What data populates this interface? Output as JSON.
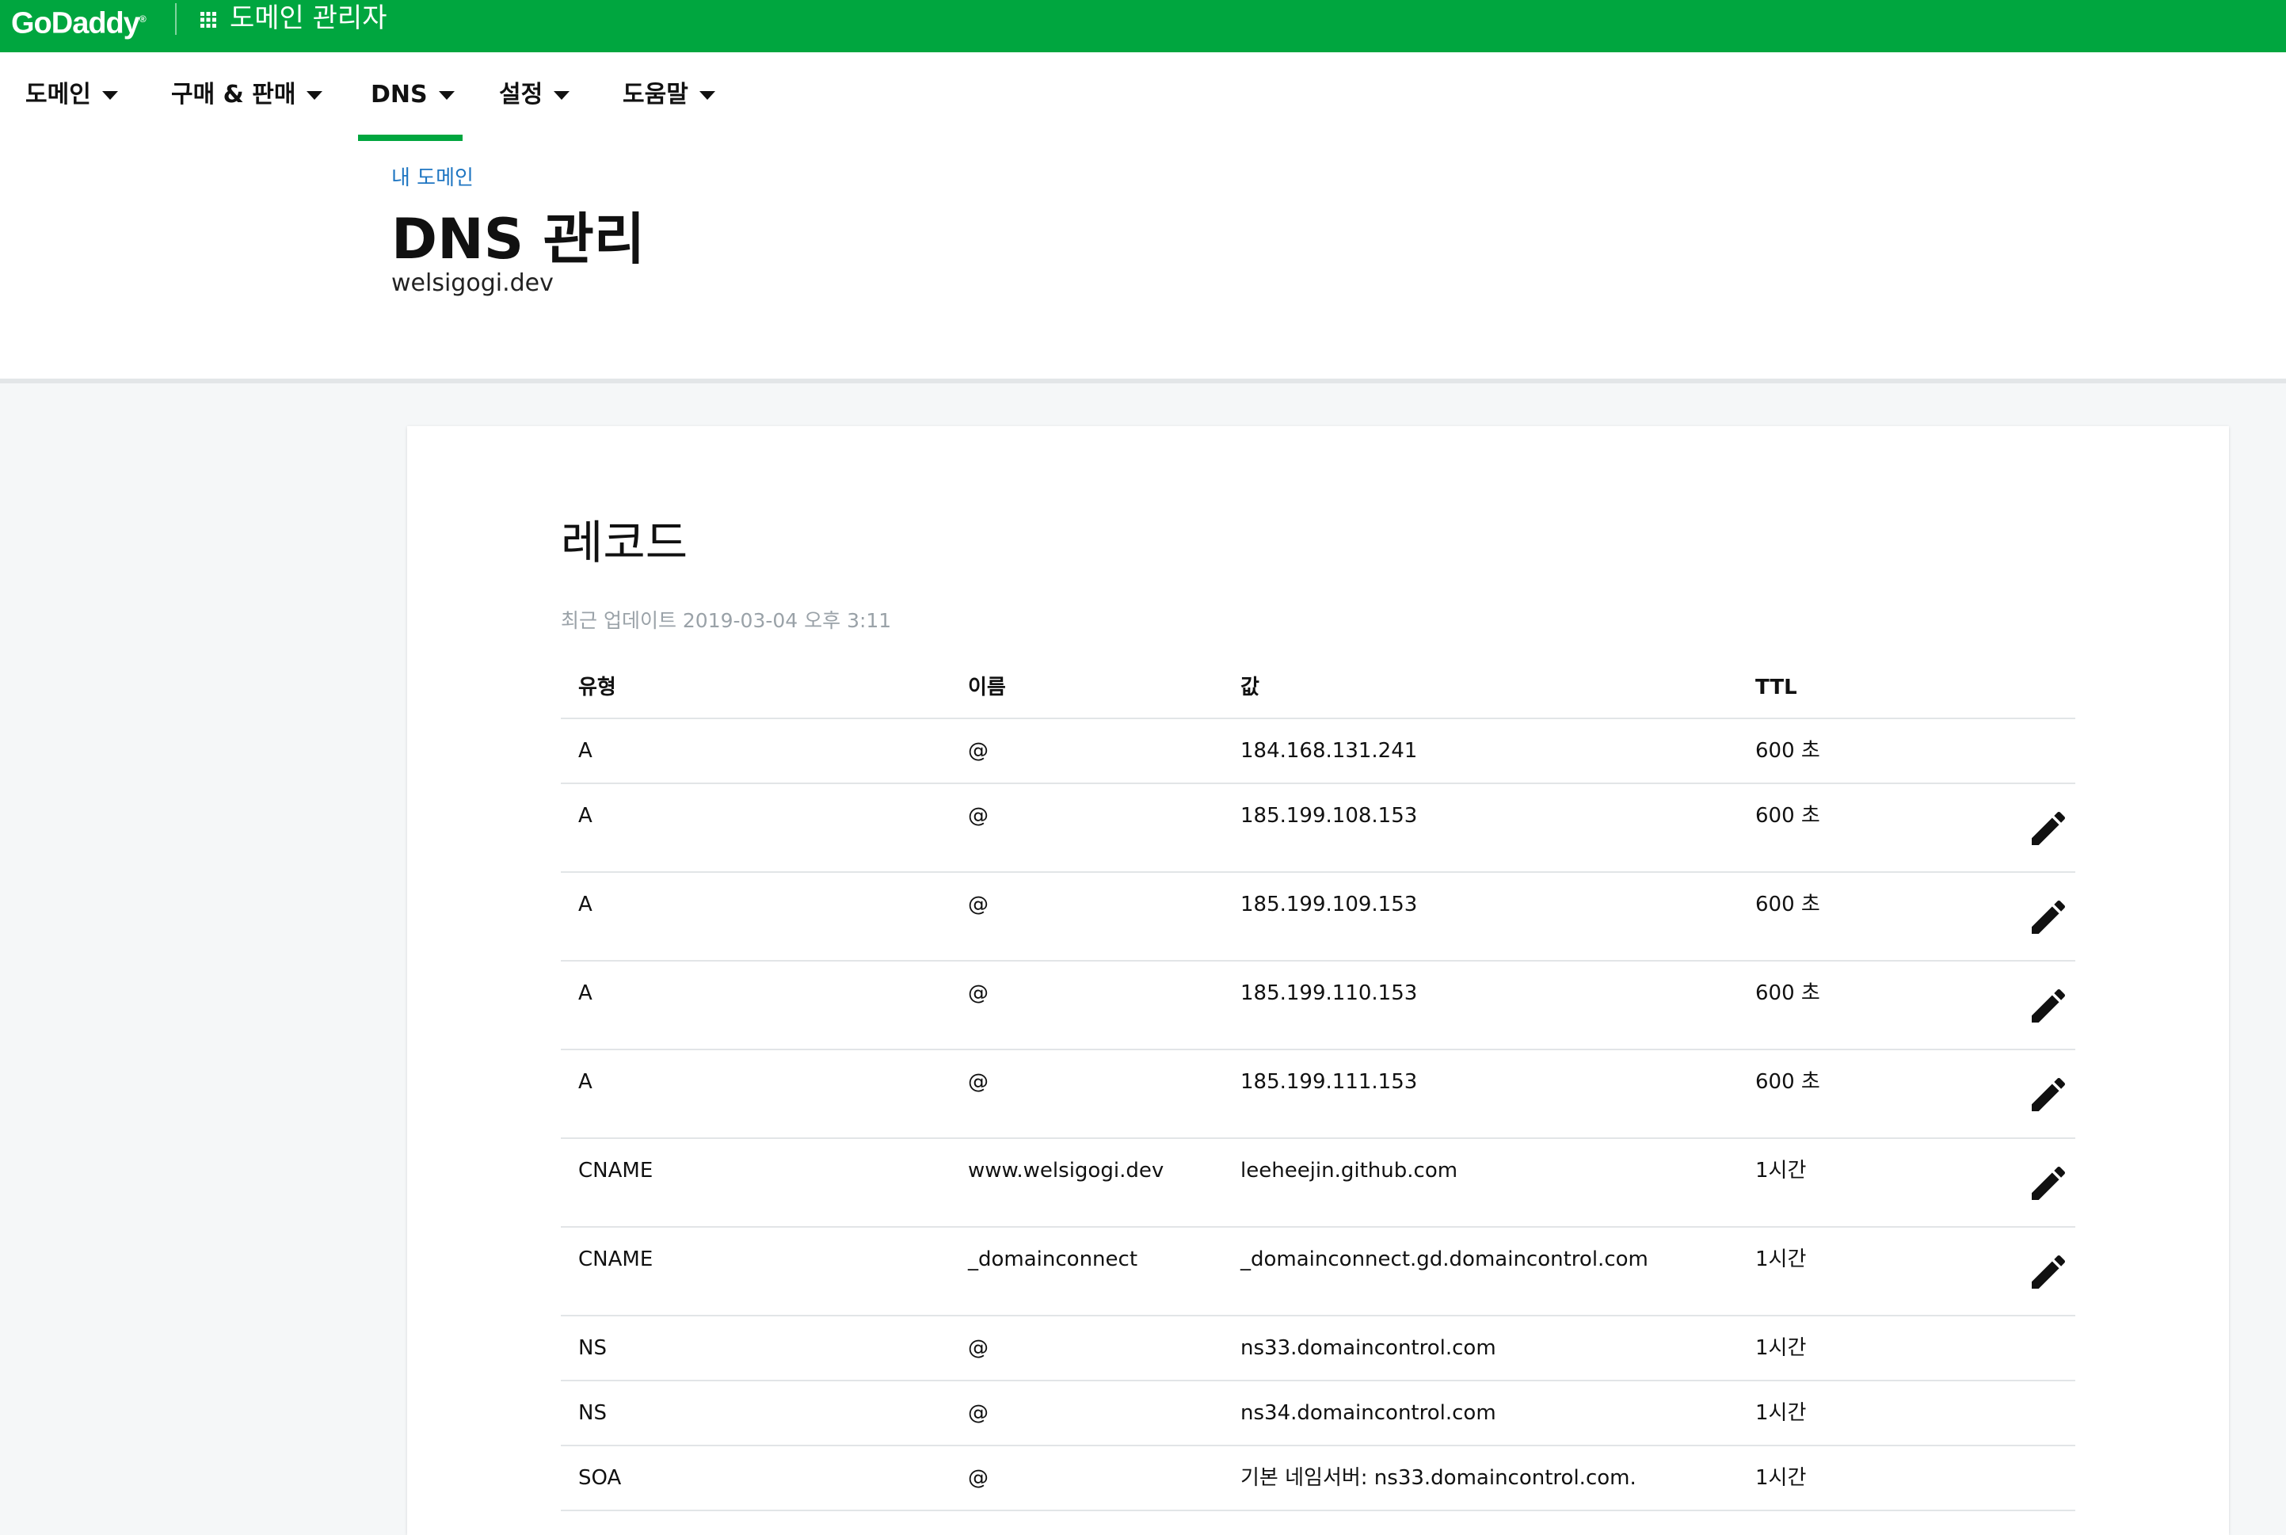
{
  "topbar": {
    "logo": "GoDaddy",
    "logo_mark": "®",
    "app_title": "도메인 관리자",
    "brand_color": "#00a63f"
  },
  "nav": {
    "items": [
      {
        "label": "도메인"
      },
      {
        "label": "구매 & 판매"
      },
      {
        "label": "DNS",
        "active": true
      },
      {
        "label": "설정"
      },
      {
        "label": "도움말"
      }
    ]
  },
  "header": {
    "breadcrumb": "내 도메인",
    "title": "DNS 관리",
    "domain": "welsigogi.dev"
  },
  "records": {
    "title": "레코드",
    "updated": "최근 업데이트 2019-03-04 오후 3:11",
    "columns": [
      "유형",
      "이름",
      "값",
      "TTL"
    ],
    "rows": [
      {
        "type": "A",
        "name": "@",
        "value": "184.168.131.241",
        "ttl": "600 초",
        "editable": false
      },
      {
        "type": "A",
        "name": "@",
        "value": "185.199.108.153",
        "ttl": "600 초",
        "editable": true
      },
      {
        "type": "A",
        "name": "@",
        "value": "185.199.109.153",
        "ttl": "600 초",
        "editable": true
      },
      {
        "type": "A",
        "name": "@",
        "value": "185.199.110.153",
        "ttl": "600 초",
        "editable": true
      },
      {
        "type": "A",
        "name": "@",
        "value": "185.199.111.153",
        "ttl": "600 초",
        "editable": true
      },
      {
        "type": "CNAME",
        "name": "www.welsigogi.dev",
        "value": "leeheejin.github.com",
        "ttl": "1시간",
        "editable": true
      },
      {
        "type": "CNAME",
        "name": "_domainconnect",
        "value": "_domainconnect.gd.domaincontrol.com",
        "ttl": "1시간",
        "editable": true
      },
      {
        "type": "NS",
        "name": "@",
        "value": "ns33.domaincontrol.com",
        "ttl": "1시간",
        "editable": false
      },
      {
        "type": "NS",
        "name": "@",
        "value": "ns34.domaincontrol.com",
        "ttl": "1시간",
        "editable": false
      },
      {
        "type": "SOA",
        "name": "@",
        "value": "기본 네임서버: ns33.domaincontrol.com.",
        "ttl": "1시간",
        "editable": false
      }
    ]
  },
  "icons": {
    "edit": "pencil-icon",
    "apps": "grid-icon",
    "dropdown": "caret-down-icon"
  }
}
